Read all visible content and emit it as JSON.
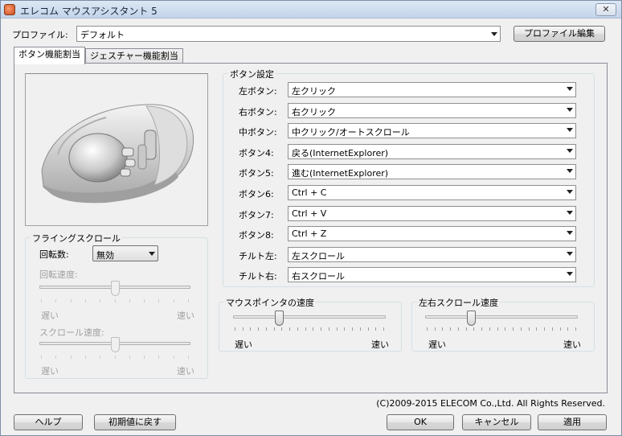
{
  "window": {
    "title": "エレコム マウスアシスタント 5",
    "close": "✕"
  },
  "profile": {
    "label": "プロファイル:",
    "value": "デフォルト",
    "edit_button": "プロファイル編集"
  },
  "tabs": [
    {
      "label": "ボタン機能割当"
    },
    {
      "label": "ジェスチャー機能割当"
    }
  ],
  "flying_scroll": {
    "title": "フライングスクロール",
    "rotation_label": "回転数:",
    "rotation_value": "無効",
    "rotation_speed_label": "回転速度:",
    "rotation_speed_level": 0.5,
    "scroll_speed_label": "スクロール速度:",
    "scroll_speed_level": 0.5,
    "slow": "遅い",
    "fast": "速い"
  },
  "button_settings": {
    "title": "ボタン設定",
    "rows": [
      {
        "label": "左ボタン:",
        "value": "左クリック"
      },
      {
        "label": "右ボタン:",
        "value": "右クリック"
      },
      {
        "label": "中ボタン:",
        "value": "中クリック/オートスクロール"
      },
      {
        "label": "ボタン4:",
        "value": "戻る(InternetExplorer)"
      },
      {
        "label": "ボタン5:",
        "value": "進む(InternetExplorer)"
      },
      {
        "label": "ボタン6:",
        "value": "Ctrl + C"
      },
      {
        "label": "ボタン7:",
        "value": "Ctrl + V"
      },
      {
        "label": "ボタン8:",
        "value": "Ctrl + Z"
      },
      {
        "label": "チルト左:",
        "value": "左スクロール"
      },
      {
        "label": "チルト右:",
        "value": "右スクロール"
      }
    ]
  },
  "pointer_speed": {
    "title": "マウスポインタの速度",
    "slow": "遅い",
    "fast": "速い",
    "level": 0.3
  },
  "hscroll_speed": {
    "title": "左右スクロール速度",
    "slow": "遅い",
    "fast": "速い",
    "level": 0.3
  },
  "copyright": "(C)2009-2015 ELECOM Co.,Ltd. All Rights Reserved.",
  "footer": {
    "help": "ヘルプ",
    "reset": "初期値に戻す",
    "ok": "OK",
    "cancel": "キャンセル",
    "apply": "適用"
  }
}
